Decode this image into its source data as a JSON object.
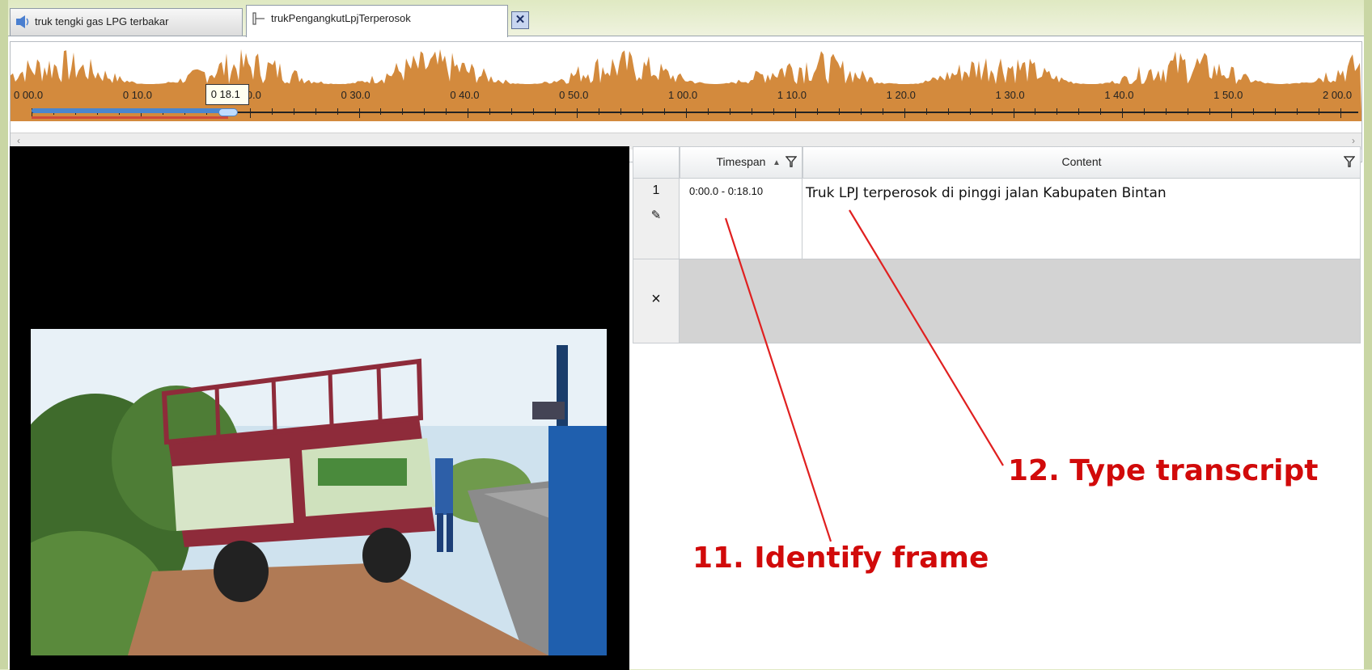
{
  "tabs": [
    {
      "label": "truk tengki gas LPG terbakar",
      "icon": "speaker-icon",
      "active": false
    },
    {
      "label": "trukPengangkutLpjTerperosok",
      "icon": "media-icon",
      "active": true
    }
  ],
  "tab_close_glyph": "✕",
  "timeline": {
    "tick_labels": [
      "0 00.0",
      "0 10.0",
      "0 20.0",
      "0 30.0",
      "0 40.0",
      "0 50.0",
      "1 00.0",
      "1 10.0",
      "1 20.0",
      "1 30.0",
      "1 40.0",
      "1 50.0",
      "2 00.0"
    ],
    "playhead_time_label": "0 18.1",
    "playhead_fraction": 0.15,
    "waveform_color": "#d38a3d"
  },
  "grid": {
    "columns": {
      "timespan": "Timespan",
      "content": "Content"
    },
    "rows": [
      {
        "index": "1",
        "timespan": "0:00.0 - 0:18.10",
        "content": "Truk LPJ terperosok di pinggi jalan Kabupaten Bintan"
      }
    ],
    "new_row_marker": "×",
    "edit_marker": "✎"
  },
  "annotations": {
    "step11": "11. Identify frame",
    "step12": "12. Type transcript",
    "color": "#d10a0a"
  }
}
